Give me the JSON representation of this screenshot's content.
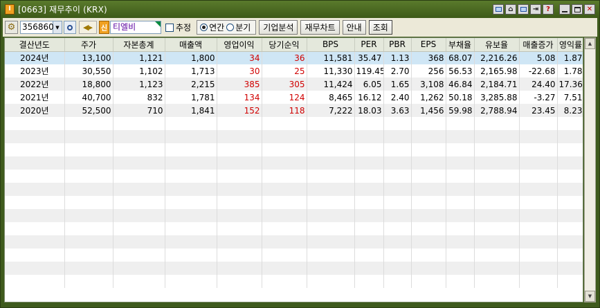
{
  "window": {
    "title": "[0663] 재무추이 (KRX)",
    "app_icon_text": "I"
  },
  "toolbar": {
    "code_value": "356860",
    "badge_text": "신",
    "company_name": "티엘비",
    "estimate_label": "추정",
    "radio_annual": "연간",
    "radio_quarter": "분기",
    "btn_company_analysis": "기업분석",
    "btn_financial_chart": "재무차트",
    "btn_guide": "안내",
    "btn_search": "조회"
  },
  "title_buttons": {
    "help": "?"
  },
  "table": {
    "headers": [
      "결산년도",
      "주가",
      "자본총계",
      "매출액",
      "영업이익",
      "당기순익",
      "BPS",
      "PER",
      "PBR",
      "EPS",
      "부채율",
      "유보율",
      "매출증가",
      "영익률"
    ],
    "rows": [
      [
        "2024년",
        "13,100",
        "1,121",
        "1,800",
        "34",
        "36",
        "11,581",
        "35.47",
        "1.13",
        "368",
        "68.07",
        "2,216.26",
        "5.08",
        "1.87"
      ],
      [
        "2023년",
        "30,550",
        "1,102",
        "1,713",
        "30",
        "25",
        "11,330",
        "119.45",
        "2.70",
        "256",
        "56.53",
        "2,165.98",
        "-22.68",
        "1.78"
      ],
      [
        "2022년",
        "18,800",
        "1,123",
        "2,215",
        "385",
        "305",
        "11,424",
        "6.05",
        "1.65",
        "3,108",
        "46.84",
        "2,184.71",
        "24.40",
        "17.36"
      ],
      [
        "2021년",
        "40,700",
        "832",
        "1,781",
        "134",
        "124",
        "8,465",
        "16.12",
        "2.40",
        "1,262",
        "50.18",
        "3,285.88",
        "-3.27",
        "7.51"
      ],
      [
        "2020년",
        "52,500",
        "710",
        "1,841",
        "152",
        "118",
        "7,222",
        "18.03",
        "3.63",
        "1,456",
        "59.98",
        "2,788.94",
        "23.45",
        "8.23"
      ]
    ]
  },
  "colors": {
    "selected_row": "#cfe6f5",
    "negative_profit_red": "#d00000",
    "window_frame": "#3f5b1d"
  }
}
